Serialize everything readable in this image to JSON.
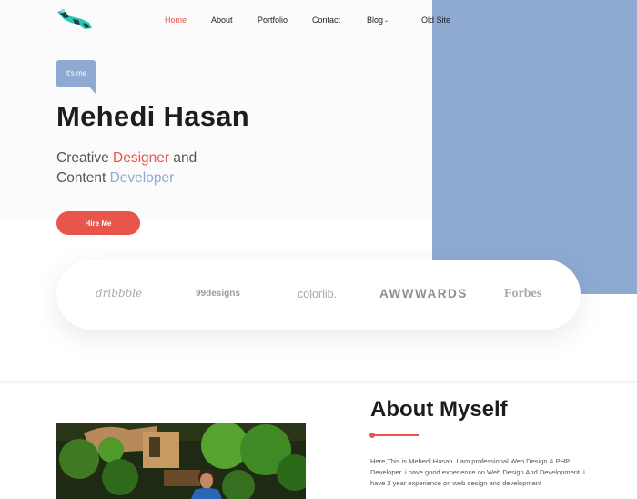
{
  "nav": {
    "items": [
      {
        "label": "Home",
        "active": true
      },
      {
        "label": "About",
        "active": false
      },
      {
        "label": "Portfolio",
        "active": false
      },
      {
        "label": "Contact",
        "active": false
      },
      {
        "label": "Blog",
        "active": false
      },
      {
        "label": "Old Site",
        "active": false
      }
    ]
  },
  "hero": {
    "bubble": "It's me",
    "name": "Mehedi Hasan",
    "tagline": {
      "p1": "Creative ",
      "highlight1": "Designer",
      "p2": " and",
      "p3": "Content ",
      "highlight2": "Developer"
    },
    "cta": "Hire Me"
  },
  "brands": [
    "dribbble",
    "99designs",
    "colorlib.",
    "AWWWARDS",
    "Forbes"
  ],
  "about": {
    "title": "About Myself",
    "text": "Here,This is Mehedi Hasan. I am professional Web Design & PHP Developer. i have good experience on Web Design And Development..i have 2 year experience on web design and development"
  },
  "colors": {
    "accent": "#e8564b",
    "blue": "#8eaad2",
    "heading": "#1d1d1f"
  }
}
